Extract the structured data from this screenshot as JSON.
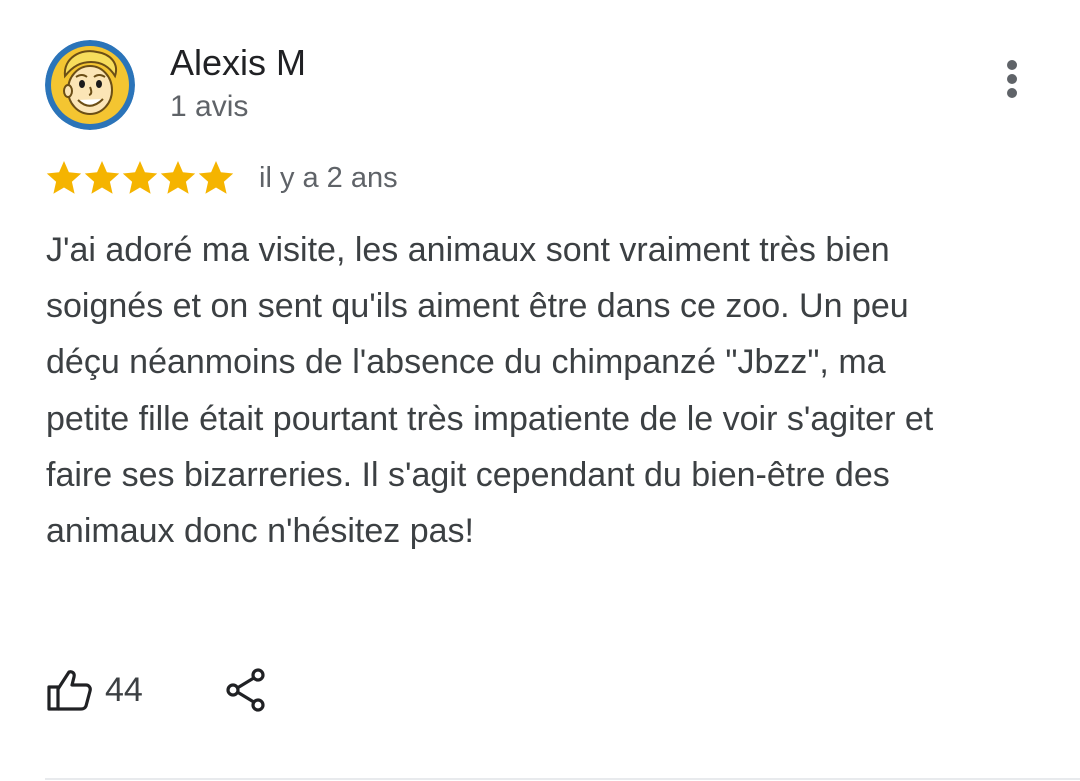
{
  "review": {
    "author": {
      "name": "Alexis M",
      "meta": "1 avis",
      "avatar_icon": "vault-boy-avatar-icon"
    },
    "rating": {
      "stars": 5,
      "max_stars": 5,
      "star_color": "#f5b400"
    },
    "date": "il y a 2 ans",
    "text": "J'ai adoré ma visite, les animaux sont vraiment très bien soignés et on sent qu'ils aiment être dans ce zoo. Un peu déçu néanmoins de l'absence du chimpanzé \"Jbzz\", ma petite fille était pourtant très impatiente de le voir s'agiter et faire ses bizarreries. Il s'agit cependant du bien-être des animaux donc n'hésitez pas!",
    "actions": {
      "like_icon": "thumb-up-icon",
      "like_count": "44",
      "share_icon": "share-icon",
      "more_icon": "more-vert-icon"
    }
  },
  "colors": {
    "primary_text": "#202124",
    "secondary_text": "#5f6368",
    "body_text": "#3c4043",
    "star": "#f5b400",
    "divider": "#e8eaed"
  }
}
